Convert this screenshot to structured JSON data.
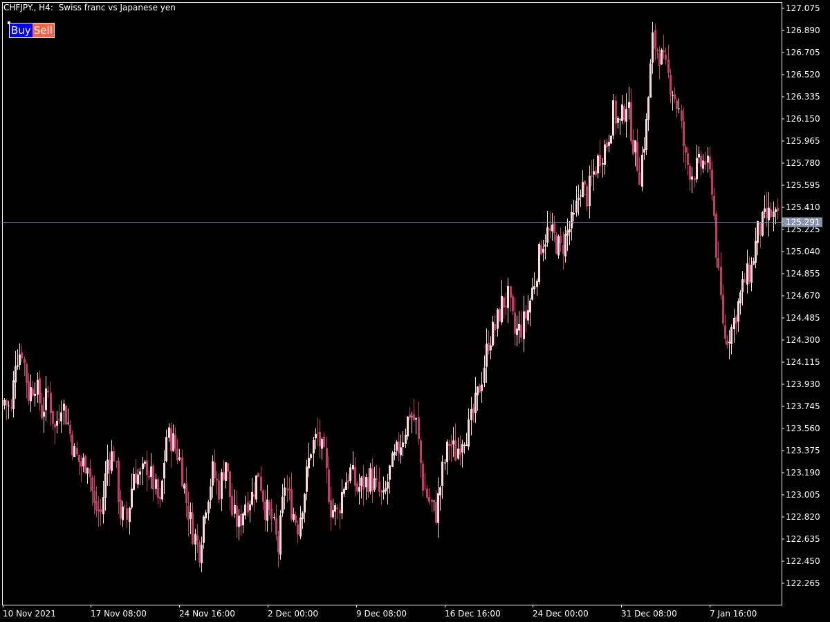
{
  "header": {
    "symbol_tf": "CHFJPY., H4:",
    "description": "Swiss franc vs Japanese yen"
  },
  "trade_panel": {
    "buy_label": "Buy",
    "sell_label": "Sell"
  },
  "colors": {
    "background": "#000000",
    "frame": "#ffffff",
    "candle_up": "#ffdada",
    "candle_down": "#c8386a",
    "price_line": "#8a95ad",
    "price_tag_bg": "#8a95ad",
    "doji": "#00c800"
  },
  "chart_data": {
    "type": "candlestick",
    "title": "CHFJPY., H4:  Swiss franc vs Japanese yen",
    "grid": false,
    "ylim": [
      122.18,
      127.1
    ],
    "y_ticks": [
      "127.075",
      "126.890",
      "126.705",
      "126.520",
      "126.335",
      "126.150",
      "125.965",
      "125.780",
      "125.595",
      "125.410",
      "125.225",
      "125.040",
      "124.855",
      "124.670",
      "124.485",
      "124.300",
      "124.115",
      "123.930",
      "123.745",
      "123.560",
      "123.375",
      "123.190",
      "123.005",
      "122.820",
      "122.635",
      "122.450",
      "122.265"
    ],
    "x_ticks": [
      "10 Nov 2021",
      "17 Nov 08:00",
      "24 Nov 16:00",
      "2 Dec 00:00",
      "9 Dec 08:00",
      "16 Dec 16:00",
      "24 Dec 00:00",
      "31 Dec 08:00",
      "7 Jan 16:00"
    ],
    "current_price": "125.291",
    "current_price_value": 125.291,
    "close_trace": [
      [
        0,
        123.8
      ],
      [
        3,
        123.7
      ],
      [
        5,
        124.15
      ],
      [
        8,
        124.22
      ],
      [
        11,
        123.85
      ],
      [
        14,
        123.95
      ],
      [
        17,
        123.7
      ],
      [
        20,
        123.85
      ],
      [
        23,
        123.55
      ],
      [
        26,
        123.8
      ],
      [
        29,
        123.6
      ],
      [
        32,
        123.35
      ],
      [
        35,
        123.25
      ],
      [
        38,
        123.3
      ],
      [
        41,
        122.9
      ],
      [
        44,
        122.85
      ],
      [
        47,
        123.3
      ],
      [
        50,
        123.35
      ],
      [
        53,
        122.85
      ],
      [
        56,
        122.8
      ],
      [
        59,
        123.2
      ],
      [
        62,
        123.15
      ],
      [
        65,
        123.25
      ],
      [
        68,
        123.1
      ],
      [
        71,
        122.9
      ],
      [
        74,
        123.5
      ],
      [
        77,
        123.45
      ],
      [
        80,
        123.3
      ],
      [
        83,
        122.95
      ],
      [
        86,
        122.7
      ],
      [
        89,
        122.55
      ],
      [
        92,
        122.95
      ],
      [
        95,
        123.2
      ],
      [
        98,
        123.05
      ],
      [
        101,
        123.3
      ],
      [
        104,
        122.85
      ],
      [
        107,
        122.75
      ],
      [
        110,
        122.95
      ],
      [
        113,
        123.0
      ],
      [
        116,
        123.2
      ],
      [
        119,
        122.9
      ],
      [
        122,
        122.8
      ],
      [
        125,
        122.55
      ],
      [
        128,
        123.1
      ],
      [
        131,
        122.9
      ],
      [
        134,
        122.75
      ],
      [
        137,
        123.05
      ],
      [
        140,
        123.4
      ],
      [
        143,
        123.5
      ],
      [
        146,
        123.3
      ],
      [
        149,
        122.9
      ],
      [
        152,
        122.85
      ],
      [
        155,
        123.1
      ],
      [
        158,
        123.2
      ],
      [
        161,
        123.05
      ],
      [
        164,
        123.1
      ],
      [
        167,
        123.15
      ],
      [
        170,
        123.05
      ],
      [
        173,
        122.95
      ],
      [
        176,
        123.2
      ],
      [
        179,
        123.35
      ],
      [
        182,
        123.5
      ],
      [
        185,
        123.7
      ],
      [
        188,
        123.6
      ],
      [
        191,
        123.1
      ],
      [
        194,
        122.95
      ],
      [
        197,
        122.85
      ],
      [
        200,
        123.2
      ],
      [
        203,
        123.45
      ],
      [
        206,
        123.35
      ],
      [
        209,
        123.5
      ],
      [
        212,
        123.55
      ],
      [
        215,
        123.75
      ],
      [
        218,
        124.0
      ],
      [
        221,
        124.3
      ],
      [
        224,
        124.4
      ],
      [
        227,
        124.6
      ],
      [
        230,
        124.65
      ],
      [
        233,
        124.35
      ],
      [
        236,
        124.4
      ],
      [
        239,
        124.55
      ],
      [
        242,
        124.8
      ],
      [
        245,
        125.1
      ],
      [
        248,
        125.2
      ],
      [
        251,
        125.15
      ],
      [
        254,
        125.05
      ],
      [
        257,
        125.2
      ],
      [
        260,
        125.3
      ],
      [
        263,
        125.6
      ],
      [
        266,
        125.5
      ],
      [
        269,
        125.7
      ],
      [
        272,
        125.85
      ],
      [
        275,
        125.95
      ],
      [
        278,
        126.2
      ],
      [
        281,
        126.1
      ],
      [
        284,
        126.3
      ],
      [
        287,
        125.95
      ],
      [
        290,
        125.7
      ],
      [
        293,
        126.1
      ],
      [
        296,
        126.8
      ],
      [
        299,
        126.7
      ],
      [
        302,
        126.55
      ],
      [
        305,
        126.4
      ],
      [
        308,
        126.2
      ],
      [
        311,
        125.8
      ],
      [
        314,
        125.7
      ],
      [
        317,
        125.75
      ],
      [
        320,
        125.8
      ],
      [
        323,
        125.6
      ],
      [
        326,
        124.8
      ],
      [
        329,
        124.3
      ],
      [
        332,
        124.4
      ],
      [
        335,
        124.6
      ],
      [
        338,
        124.8
      ],
      [
        341,
        124.9
      ],
      [
        344,
        125.2
      ],
      [
        347,
        125.3
      ],
      [
        350,
        125.35
      ],
      [
        353,
        125.29
      ]
    ]
  }
}
